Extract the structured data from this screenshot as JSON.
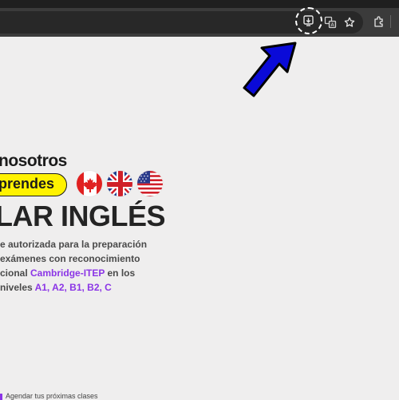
{
  "browser": {
    "icons": [
      "install-app-icon",
      "translate-icon",
      "bookmark-star-icon",
      "extensions-icon"
    ],
    "highlight_color": "#ffffff",
    "toolbar_color": "#3b3b3b"
  },
  "annotation": {
    "arrow_color": "#0a0ad8",
    "arrow_outline": "#000000"
  },
  "hero": {
    "line1": "nosotros",
    "pill_text": "prendes",
    "headline": "LAR INGLÉS",
    "flags": [
      "canada-flag-icon",
      "uk-flag-icon",
      "usa-flag-icon"
    ],
    "para_lines": [
      {
        "text": "e autorizada para la preparación"
      },
      {
        "text": "exámenes con reconocimiento"
      },
      {
        "pre": "cional ",
        "hl": "Cambridge-ITEP",
        "post": " en los"
      },
      {
        "pre": "niveles ",
        "hl": "A1, A2, B1, B2, C",
        "post": ""
      }
    ],
    "accent_color": "#8b35e6",
    "pill_color": "#fff200"
  },
  "footer": {
    "text": "Agendar tus próximas clases"
  }
}
